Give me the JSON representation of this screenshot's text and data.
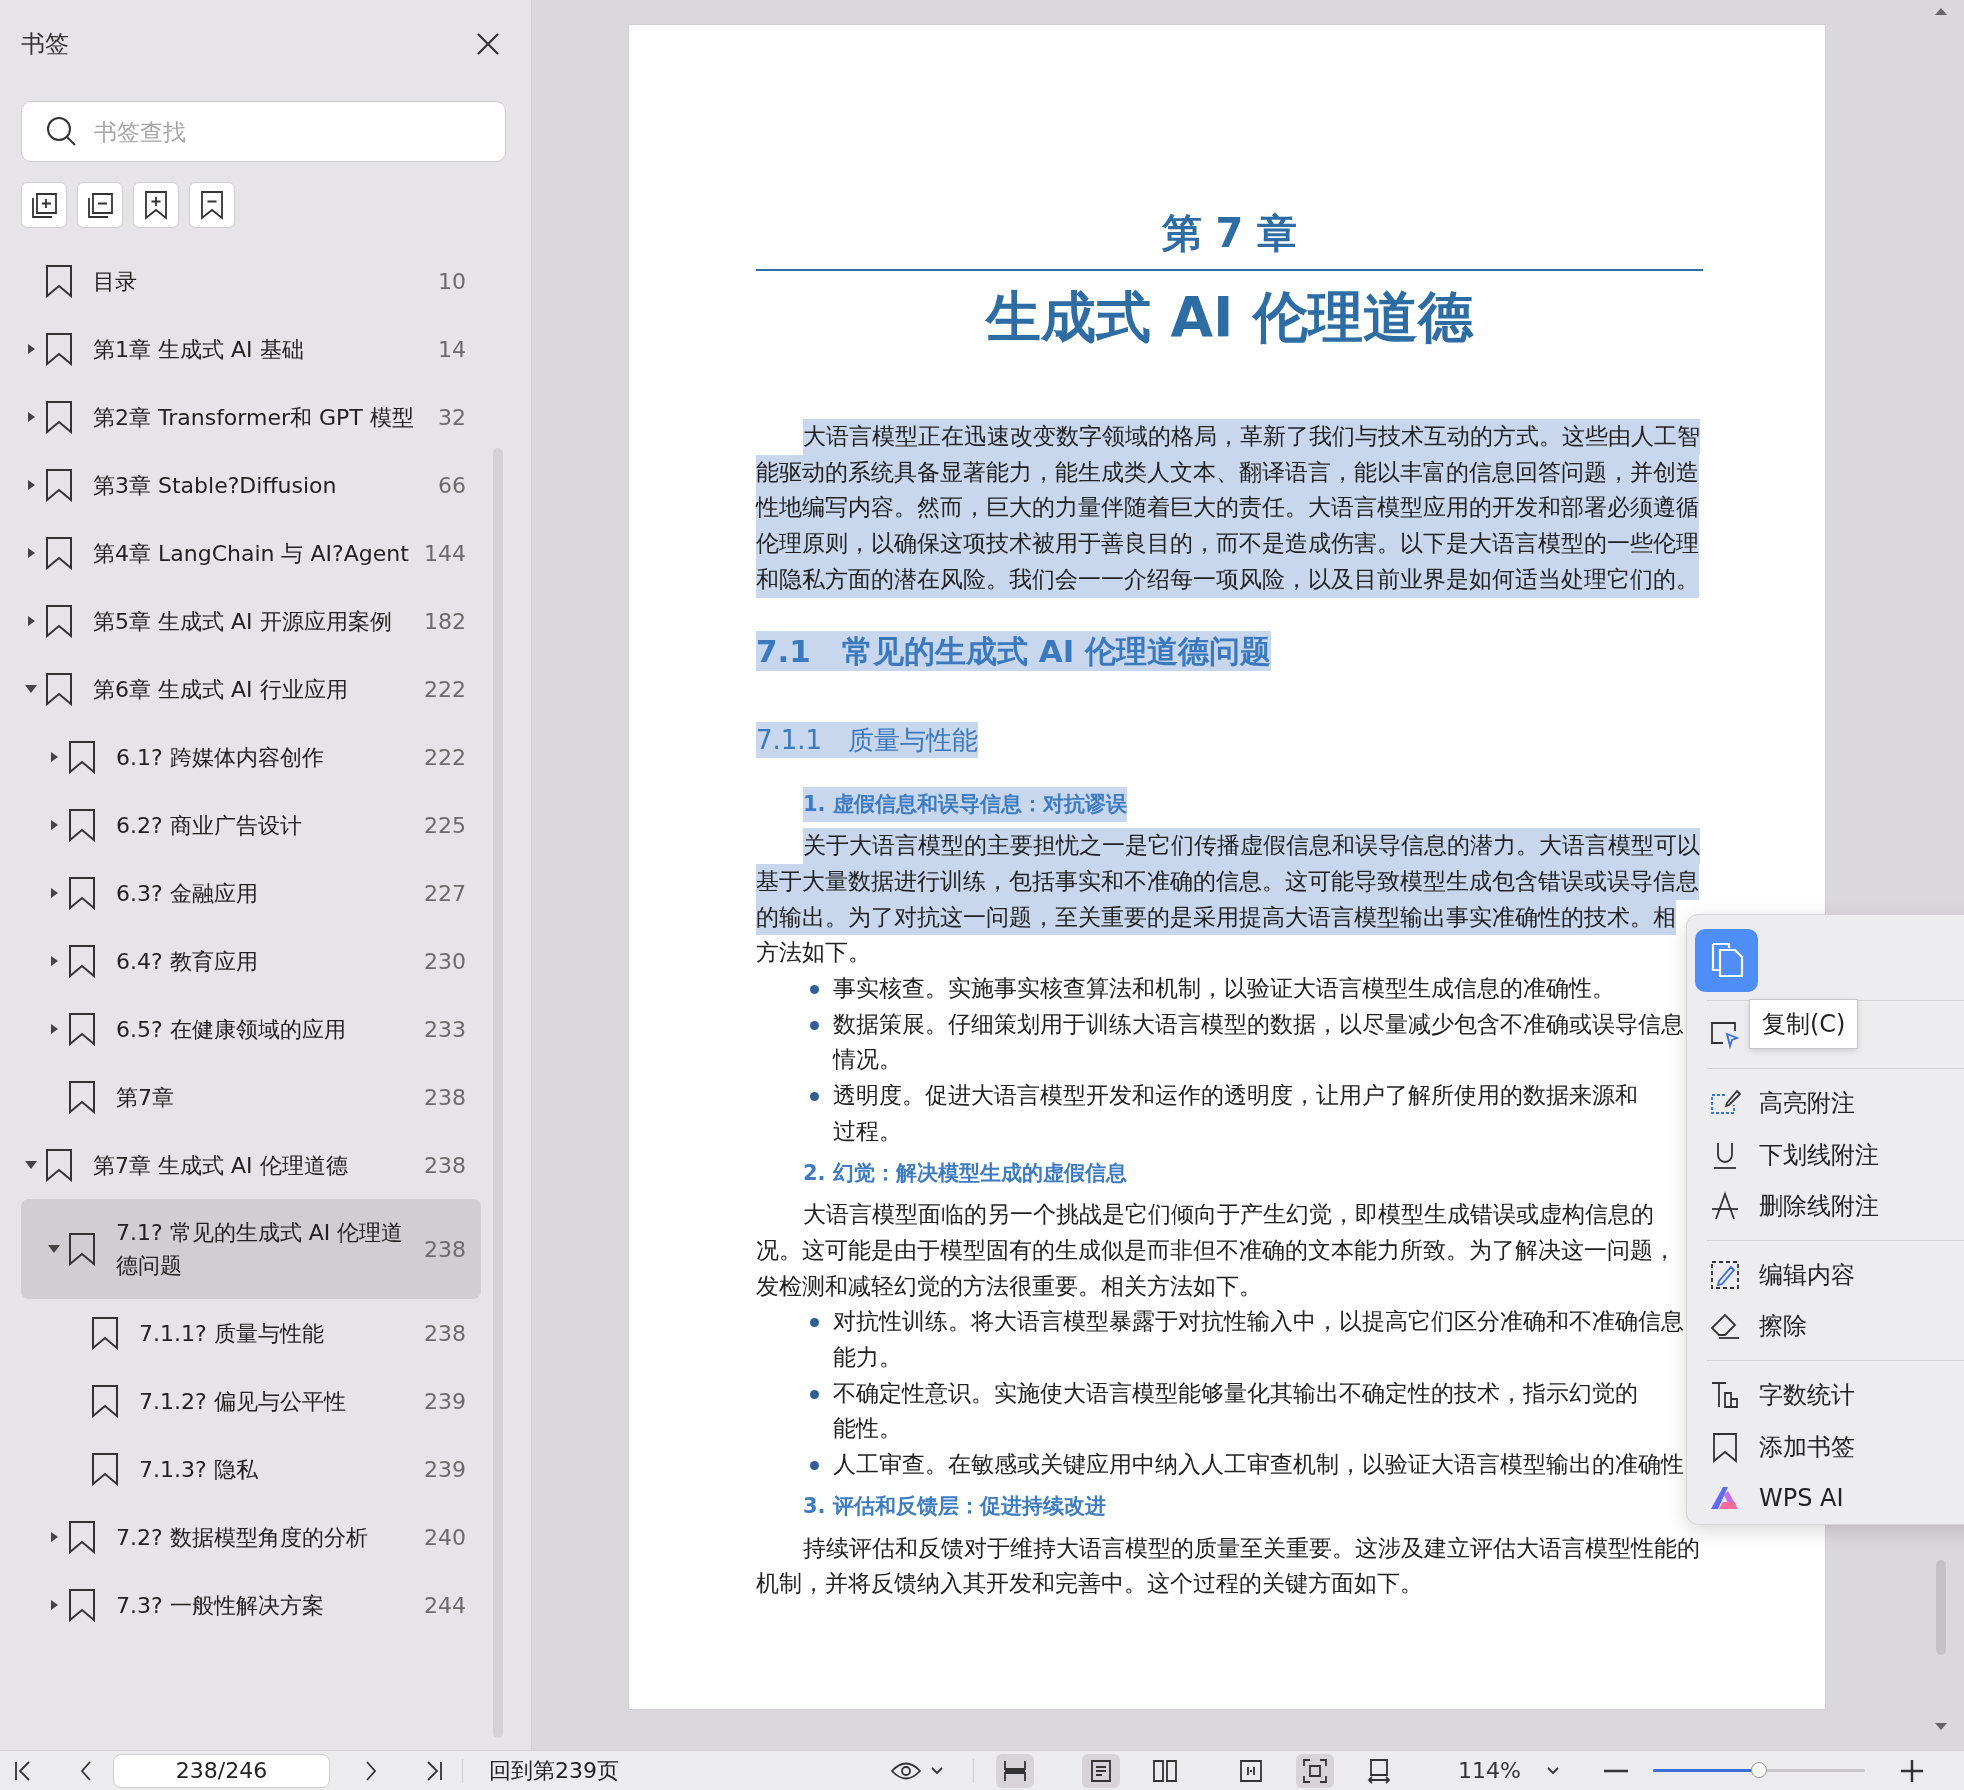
{
  "sidebar": {
    "title": "书签",
    "search": {
      "placeholder": "书签查找"
    },
    "bookmarks": [
      {
        "label": "目录",
        "page": "10",
        "selected": false
      },
      {
        "label": "第1章  生成式 AI 基础",
        "page": "14",
        "expanded": false,
        "selected": false
      },
      {
        "label": "第2章  Transformer和 GPT 模型",
        "page": "32",
        "expanded": false,
        "selected": false
      },
      {
        "label": "第3章  Stable?Diffusion",
        "page": "66",
        "expanded": false,
        "selected": false
      },
      {
        "label": "第4章  LangChain 与 AI?Agent",
        "page": "144",
        "expanded": false,
        "selected": false
      },
      {
        "label": "第5章  生成式 AI 开源应用案例",
        "page": "182",
        "expanded": false,
        "selected": false
      },
      {
        "label": "第6章  生成式 AI 行业应用",
        "page": "222",
        "expanded": true,
        "selected": false,
        "children": [
          {
            "label": "6.1? 跨媒体内容创作",
            "page": "222",
            "expanded": false,
            "selected": false
          },
          {
            "label": "6.2? 商业广告设计",
            "page": "225",
            "expanded": false,
            "selected": false
          },
          {
            "label": "6.3? 金融应用",
            "page": "227",
            "expanded": false,
            "selected": false
          },
          {
            "label": "6.4? 教育应用",
            "page": "230",
            "expanded": false,
            "selected": false
          },
          {
            "label": "6.5? 在健康领域的应用",
            "page": "233",
            "expanded": false,
            "selected": false
          },
          {
            "label": "第7章",
            "page": "238",
            "selected": false
          }
        ]
      },
      {
        "label": "第7章  生成式 AI 伦理道德",
        "page": "238",
        "expanded": true,
        "selected": false,
        "children": [
          {
            "label": "7.1? 常见的生成式 AI 伦理道德问题",
            "page": "238",
            "expanded": true,
            "selected": true,
            "children": [
              {
                "label": "7.1.1? 质量与性能",
                "page": "238",
                "selected": false
              },
              {
                "label": "7.1.2? 偏见与公平性",
                "page": "239",
                "selected": false
              },
              {
                "label": "7.1.3? 隐私",
                "page": "239",
                "selected": false
              }
            ]
          },
          {
            "label": "7.2? 数据模型角度的分析",
            "page": "240",
            "expanded": false,
            "selected": false
          },
          {
            "label": "7.3? 一般性解决方案",
            "page": "244",
            "expanded": false,
            "selected": false
          }
        ]
      }
    ]
  },
  "document": {
    "blocks": [
      {
        "kind": "chapter",
        "text": "第 7 章"
      },
      {
        "kind": "title",
        "text": "生成式 AI 伦理道德"
      },
      {
        "kind": "para",
        "selected": true,
        "lines": [
          "大语言模型正在迅速改变数字领域的格局，革新了我们与技术互动的方式。这些由人工智",
          "能驱动的系统具备显著能力，能生成类人文本、翻译语言，能以丰富的信息回答问题，并创造",
          "性地编写内容。然而，巨大的力量伴随着巨大的责任。大语言模型应用的开发和部署必须遵循",
          "伦理原则，以确保这项技术被用于善良目的，而不是造成伤害。以下是大语言模型的一些伦理",
          "和隐私方面的潜在风险。我们会一一介绍每一项风险，以及目前业界是如何适当处理它们的。"
        ]
      },
      {
        "kind": "h2",
        "selected": true,
        "text": "7.1　常见的生成式 AI 伦理道德问题"
      },
      {
        "kind": "h3",
        "selected": true,
        "text": "7.1.1　质量与性能"
      },
      {
        "kind": "h4",
        "selected": true,
        "text": "1. 虚假信息和误导信息：对抗谬误"
      },
      {
        "kind": "para",
        "selected": true,
        "lines": [
          "关于大语言模型的主要担忧之一是它们传播虚假信息和误导信息的潜力。大语言模型可以",
          "基于大量数据进行训练，包括事实和不准确的信息。这可能导致模型生成包含错误或误导信息",
          "的输出。为了对抗这一问题，至关重要的是采用提高大语言模型输出事实准确性的技术。相"
        ]
      },
      {
        "kind": "cont",
        "selected": false,
        "lines": [
          "方法如下。"
        ]
      },
      {
        "kind": "bullet",
        "lines": [
          "事实核查。实施事实核查算法和机制，以验证大语言模型生成信息的准确性。"
        ]
      },
      {
        "kind": "bullet",
        "lines": [
          "数据策展。仔细策划用于训练大语言模型的数据，以尽量减少包含不准确或误导信息",
          "情况。"
        ]
      },
      {
        "kind": "bullet",
        "lines": [
          "透明度。促进大语言模型开发和运作的透明度，让用户了解所使用的数据来源和",
          "过程。"
        ]
      },
      {
        "kind": "h4",
        "selected": false,
        "text": "2. 幻觉：解决模型生成的虚假信息"
      },
      {
        "kind": "para",
        "selected": false,
        "lines": [
          "大语言模型面临的另一个挑战是它们倾向于产生幻觉，即模型生成错误或虚构信息的",
          "况。这可能是由于模型固有的生成似是而非但不准确的文本能力所致。为了解决这一问题，",
          "发检测和减轻幻觉的方法很重要。相关方法如下。"
        ]
      },
      {
        "kind": "bullet",
        "lines": [
          "对抗性训练。将大语言模型暴露于对抗性输入中，以提高它们区分准确和不准确信息",
          "能力。"
        ]
      },
      {
        "kind": "bullet",
        "lines": [
          "不确定性意识。实施使大语言模型能够量化其输出不确定性的技术，指示幻觉的",
          "能性。"
        ]
      },
      {
        "kind": "bullet",
        "lines": [
          "人工审查。在敏感或关键应用中纳入人工审查机制，以验证大语言模型输出的准确性"
        ]
      },
      {
        "kind": "h4",
        "selected": false,
        "text": "3. 评估和反馈层：促进持续改进"
      },
      {
        "kind": "para",
        "selected": false,
        "lines": [
          "持续评估和反馈对于维持大语言模型的质量至关重要。这涉及建立评估大语言模型性能的",
          "机制，并将反馈纳入其开发和完善中。这个过程的关键方面如下。"
        ]
      }
    ]
  },
  "context_menu": {
    "copy_tooltip": "复制(C)",
    "groups": [
      [
        {
          "kind": "select"
        }
      ],
      [
        {
          "kind": "highlight",
          "label": "高亮附注"
        },
        {
          "kind": "underline",
          "label": "下划线附注"
        },
        {
          "kind": "strike",
          "label": "删除线附注"
        }
      ],
      [
        {
          "kind": "edit",
          "label": "编辑内容"
        },
        {
          "kind": "erase",
          "label": "擦除"
        }
      ],
      [
        {
          "kind": "count",
          "label": "字数统计"
        },
        {
          "kind": "bookmark",
          "label": "添加书签"
        },
        {
          "kind": "ai",
          "label": "WPS AI"
        }
      ]
    ]
  },
  "status_bar": {
    "page_field": "238/246",
    "back_link": "回到第239页",
    "view_buttons": [
      {
        "kind": "continuous",
        "selected": true
      },
      {
        "kind": "single",
        "selected": true
      },
      {
        "kind": "double",
        "selected": false
      },
      {
        "kind": "fit",
        "selected": false
      },
      {
        "kind": "focus",
        "selected": true
      },
      {
        "kind": "rotate",
        "selected": false
      }
    ],
    "zoom": "114%",
    "zoom_slider": {
      "level": 0.5
    }
  }
}
